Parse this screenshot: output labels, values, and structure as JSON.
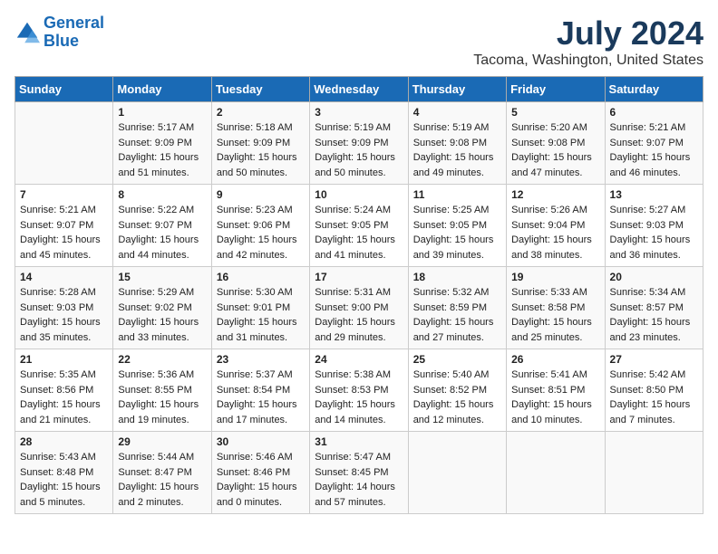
{
  "header": {
    "logo_line1": "General",
    "logo_line2": "Blue",
    "title": "July 2024",
    "subtitle": "Tacoma, Washington, United States"
  },
  "calendar": {
    "days_of_week": [
      "Sunday",
      "Monday",
      "Tuesday",
      "Wednesday",
      "Thursday",
      "Friday",
      "Saturday"
    ],
    "weeks": [
      [
        {
          "day": "",
          "sunrise": "",
          "sunset": "",
          "daylight": ""
        },
        {
          "day": "1",
          "sunrise": "Sunrise: 5:17 AM",
          "sunset": "Sunset: 9:09 PM",
          "daylight": "Daylight: 15 hours and 51 minutes."
        },
        {
          "day": "2",
          "sunrise": "Sunrise: 5:18 AM",
          "sunset": "Sunset: 9:09 PM",
          "daylight": "Daylight: 15 hours and 50 minutes."
        },
        {
          "day": "3",
          "sunrise": "Sunrise: 5:19 AM",
          "sunset": "Sunset: 9:09 PM",
          "daylight": "Daylight: 15 hours and 50 minutes."
        },
        {
          "day": "4",
          "sunrise": "Sunrise: 5:19 AM",
          "sunset": "Sunset: 9:08 PM",
          "daylight": "Daylight: 15 hours and 49 minutes."
        },
        {
          "day": "5",
          "sunrise": "Sunrise: 5:20 AM",
          "sunset": "Sunset: 9:08 PM",
          "daylight": "Daylight: 15 hours and 47 minutes."
        },
        {
          "day": "6",
          "sunrise": "Sunrise: 5:21 AM",
          "sunset": "Sunset: 9:07 PM",
          "daylight": "Daylight: 15 hours and 46 minutes."
        }
      ],
      [
        {
          "day": "7",
          "sunrise": "Sunrise: 5:21 AM",
          "sunset": "Sunset: 9:07 PM",
          "daylight": "Daylight: 15 hours and 45 minutes."
        },
        {
          "day": "8",
          "sunrise": "Sunrise: 5:22 AM",
          "sunset": "Sunset: 9:07 PM",
          "daylight": "Daylight: 15 hours and 44 minutes."
        },
        {
          "day": "9",
          "sunrise": "Sunrise: 5:23 AM",
          "sunset": "Sunset: 9:06 PM",
          "daylight": "Daylight: 15 hours and 42 minutes."
        },
        {
          "day": "10",
          "sunrise": "Sunrise: 5:24 AM",
          "sunset": "Sunset: 9:05 PM",
          "daylight": "Daylight: 15 hours and 41 minutes."
        },
        {
          "day": "11",
          "sunrise": "Sunrise: 5:25 AM",
          "sunset": "Sunset: 9:05 PM",
          "daylight": "Daylight: 15 hours and 39 minutes."
        },
        {
          "day": "12",
          "sunrise": "Sunrise: 5:26 AM",
          "sunset": "Sunset: 9:04 PM",
          "daylight": "Daylight: 15 hours and 38 minutes."
        },
        {
          "day": "13",
          "sunrise": "Sunrise: 5:27 AM",
          "sunset": "Sunset: 9:03 PM",
          "daylight": "Daylight: 15 hours and 36 minutes."
        }
      ],
      [
        {
          "day": "14",
          "sunrise": "Sunrise: 5:28 AM",
          "sunset": "Sunset: 9:03 PM",
          "daylight": "Daylight: 15 hours and 35 minutes."
        },
        {
          "day": "15",
          "sunrise": "Sunrise: 5:29 AM",
          "sunset": "Sunset: 9:02 PM",
          "daylight": "Daylight: 15 hours and 33 minutes."
        },
        {
          "day": "16",
          "sunrise": "Sunrise: 5:30 AM",
          "sunset": "Sunset: 9:01 PM",
          "daylight": "Daylight: 15 hours and 31 minutes."
        },
        {
          "day": "17",
          "sunrise": "Sunrise: 5:31 AM",
          "sunset": "Sunset: 9:00 PM",
          "daylight": "Daylight: 15 hours and 29 minutes."
        },
        {
          "day": "18",
          "sunrise": "Sunrise: 5:32 AM",
          "sunset": "Sunset: 8:59 PM",
          "daylight": "Daylight: 15 hours and 27 minutes."
        },
        {
          "day": "19",
          "sunrise": "Sunrise: 5:33 AM",
          "sunset": "Sunset: 8:58 PM",
          "daylight": "Daylight: 15 hours and 25 minutes."
        },
        {
          "day": "20",
          "sunrise": "Sunrise: 5:34 AM",
          "sunset": "Sunset: 8:57 PM",
          "daylight": "Daylight: 15 hours and 23 minutes."
        }
      ],
      [
        {
          "day": "21",
          "sunrise": "Sunrise: 5:35 AM",
          "sunset": "Sunset: 8:56 PM",
          "daylight": "Daylight: 15 hours and 21 minutes."
        },
        {
          "day": "22",
          "sunrise": "Sunrise: 5:36 AM",
          "sunset": "Sunset: 8:55 PM",
          "daylight": "Daylight: 15 hours and 19 minutes."
        },
        {
          "day": "23",
          "sunrise": "Sunrise: 5:37 AM",
          "sunset": "Sunset: 8:54 PM",
          "daylight": "Daylight: 15 hours and 17 minutes."
        },
        {
          "day": "24",
          "sunrise": "Sunrise: 5:38 AM",
          "sunset": "Sunset: 8:53 PM",
          "daylight": "Daylight: 15 hours and 14 minutes."
        },
        {
          "day": "25",
          "sunrise": "Sunrise: 5:40 AM",
          "sunset": "Sunset: 8:52 PM",
          "daylight": "Daylight: 15 hours and 12 minutes."
        },
        {
          "day": "26",
          "sunrise": "Sunrise: 5:41 AM",
          "sunset": "Sunset: 8:51 PM",
          "daylight": "Daylight: 15 hours and 10 minutes."
        },
        {
          "day": "27",
          "sunrise": "Sunrise: 5:42 AM",
          "sunset": "Sunset: 8:50 PM",
          "daylight": "Daylight: 15 hours and 7 minutes."
        }
      ],
      [
        {
          "day": "28",
          "sunrise": "Sunrise: 5:43 AM",
          "sunset": "Sunset: 8:48 PM",
          "daylight": "Daylight: 15 hours and 5 minutes."
        },
        {
          "day": "29",
          "sunrise": "Sunrise: 5:44 AM",
          "sunset": "Sunset: 8:47 PM",
          "daylight": "Daylight: 15 hours and 2 minutes."
        },
        {
          "day": "30",
          "sunrise": "Sunrise: 5:46 AM",
          "sunset": "Sunset: 8:46 PM",
          "daylight": "Daylight: 15 hours and 0 minutes."
        },
        {
          "day": "31",
          "sunrise": "Sunrise: 5:47 AM",
          "sunset": "Sunset: 8:45 PM",
          "daylight": "Daylight: 14 hours and 57 minutes."
        },
        {
          "day": "",
          "sunrise": "",
          "sunset": "",
          "daylight": ""
        },
        {
          "day": "",
          "sunrise": "",
          "sunset": "",
          "daylight": ""
        },
        {
          "day": "",
          "sunrise": "",
          "sunset": "",
          "daylight": ""
        }
      ]
    ]
  }
}
